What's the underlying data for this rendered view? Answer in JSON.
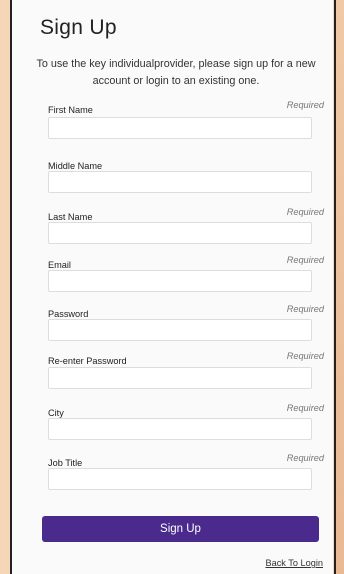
{
  "header": {
    "title": "Sign Up",
    "subtitle": "To use the key individualprovider, please sign up for a new account or login to an existing one."
  },
  "fields": [
    {
      "label": "First Name",
      "required": "Required",
      "value": ""
    },
    {
      "label": "Middle Name",
      "required": "",
      "value": ""
    },
    {
      "label": "Last Name",
      "required": "Required",
      "value": ""
    },
    {
      "label": "Email",
      "required": "Required",
      "value": ""
    },
    {
      "label": "Password",
      "required": "Required",
      "value": ""
    },
    {
      "label": "Re-enter Password",
      "required": "Required",
      "value": ""
    },
    {
      "label": "City",
      "required": "Required",
      "value": ""
    },
    {
      "label": "Job Title",
      "required": "Required",
      "value": ""
    }
  ],
  "actions": {
    "signup_label": "Sign Up",
    "back_to_login": "Back To Login"
  },
  "colors": {
    "primary": "#4a2a8c",
    "page_background": "#f5d6b8"
  }
}
